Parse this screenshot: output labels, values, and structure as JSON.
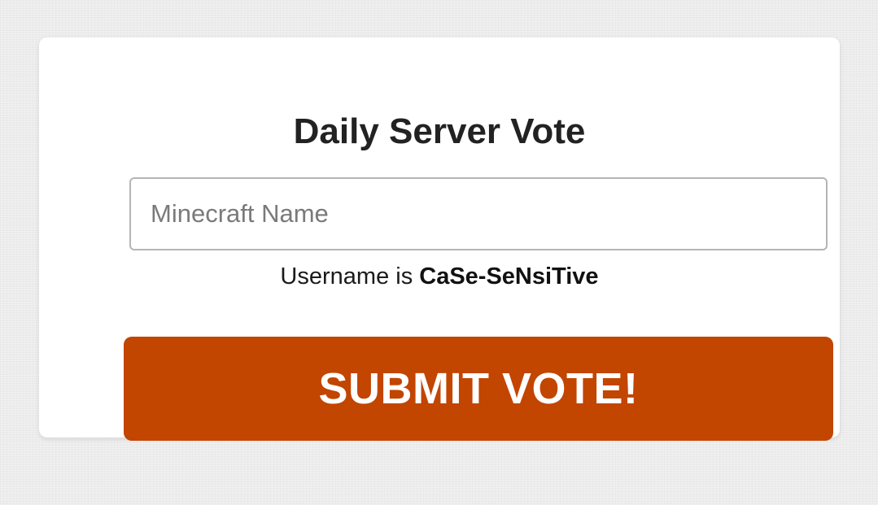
{
  "vote_form": {
    "title": "Daily Server Vote",
    "name_input": {
      "placeholder": "Minecraft Name",
      "value": ""
    },
    "hint": {
      "prefix": "Username is ",
      "emphasis": "CaSe-SeNsiTive"
    },
    "submit_label": "SUBMIT VOTE!"
  },
  "colors": {
    "page_background": "#ececec",
    "card_background": "#ffffff",
    "submit_button": "#c24500",
    "submit_text": "#ffffff",
    "title_text": "#222222"
  }
}
